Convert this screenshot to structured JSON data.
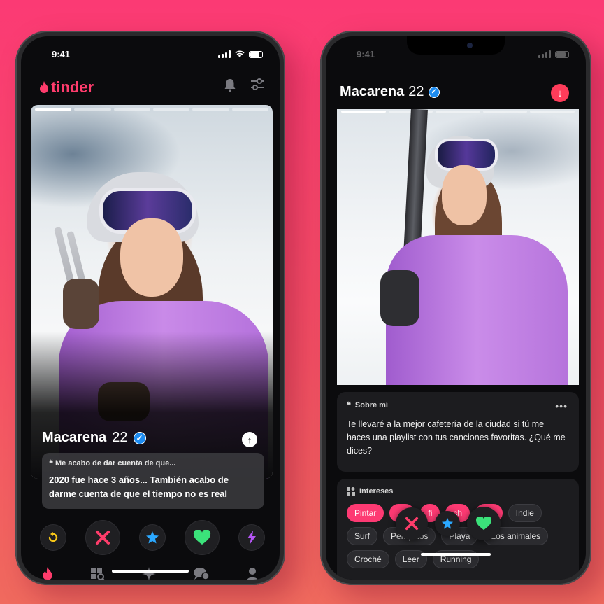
{
  "left_phone": {
    "status_time": "9:41",
    "brand": "tinder",
    "profile": {
      "name": "Macarena",
      "age": "22",
      "bio_heading": "Me acabo de dar cuenta de que...",
      "bio_text": "2020 fue hace 3 años... También acabo de darme cuenta de que el tiempo no es real"
    },
    "action_icons": [
      "rewind-icon",
      "nope-icon",
      "super-like-icon",
      "like-icon",
      "boost-icon"
    ],
    "tab_icons": [
      "tinder-flame-icon",
      "explore-icon",
      "sparkle-icon",
      "chat-icon",
      "profile-icon"
    ]
  },
  "right_phone": {
    "status_time": "9:41",
    "profile": {
      "name": "Macarena",
      "age": "22"
    },
    "about": {
      "heading": "Sobre mí",
      "text": "Te llevaré a la mejor cafetería de la ciudad si tú me haces una playlist con tus canciones favoritas. ¿Qué me dices?"
    },
    "interests": {
      "heading": "Intereses",
      "chips": [
        {
          "label": "Pintar",
          "selected": true
        },
        {
          "label": "",
          "selected": true
        },
        {
          "label": "fi",
          "selected": true
        },
        {
          "label": "ch",
          "selected": true
        },
        {
          "label": "afé",
          "selected": true
        },
        {
          "label": "Indie",
          "selected": false
        },
        {
          "label": "Surf",
          "selected": false
        },
        {
          "label": "Periquitos",
          "selected": false
        },
        {
          "label": "Playa",
          "selected": false
        },
        {
          "label": "Los animales",
          "selected": false
        },
        {
          "label": "Croché",
          "selected": false
        },
        {
          "label": "Leer",
          "selected": false
        },
        {
          "label": "Running",
          "selected": false
        }
      ]
    }
  },
  "colors": {
    "brand": "#fe3c6c",
    "verified": "#1e8cf0",
    "background_top": "#fb3a74",
    "background_bottom": "#f06a5e"
  }
}
